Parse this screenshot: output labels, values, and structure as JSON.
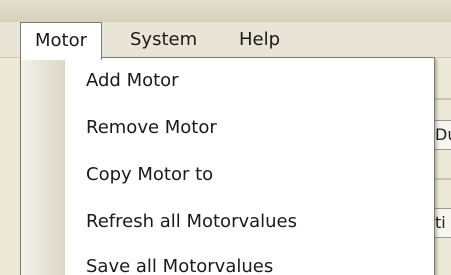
{
  "menubar": {
    "items": [
      {
        "label": "Motor",
        "open": true
      },
      {
        "label": "System",
        "open": false
      },
      {
        "label": "Help",
        "open": false
      }
    ]
  },
  "dropdown": {
    "items": [
      {
        "label": "Add Motor"
      },
      {
        "label": "Remove Motor"
      },
      {
        "label": "Copy Motor to"
      },
      {
        "label": "Refresh all Motorvalues"
      },
      {
        "label": "Save all Motorvalues"
      }
    ]
  },
  "background": {
    "field1_text": "Du",
    "field2_text": "ti"
  }
}
